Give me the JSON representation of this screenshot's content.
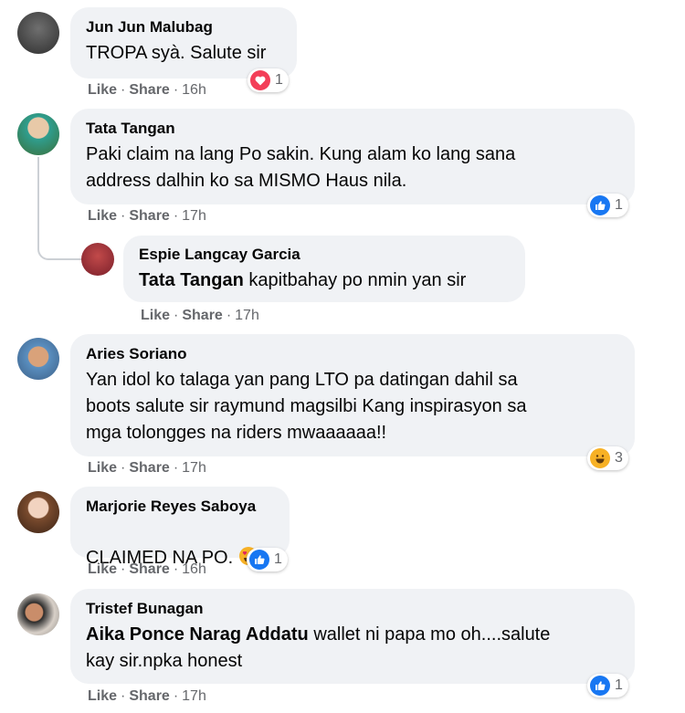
{
  "comments": [
    {
      "author": "Jun Jun Malubag",
      "text": "TROPA syà. Salute sir",
      "time": "16h",
      "reaction": "love",
      "reaction_count": "1"
    },
    {
      "author": "Tata Tangan",
      "text": "Paki claim na lang Po sakin. Kung alam ko lang sana\naddress dalhin ko sa MISMO Haus nila.",
      "time": "17h",
      "reaction": "like",
      "reaction_count": "1"
    },
    {
      "author": "Espie Langcay Garcia",
      "mention": "Tata Tangan",
      "text": " kapitbahay po nmin yan sir",
      "time": "17h"
    },
    {
      "author": "Aries Soriano",
      "text": "Yan idol ko talaga yan pang LTO pa datingan dahil sa\nboots salute sir raymund magsilbi Kang inspirasyon sa\nmga tolongges na riders mwaaaaaa!!",
      "time": "17h",
      "reaction": "haha",
      "reaction_count": "3"
    },
    {
      "author": "Marjorie Reyes Saboya",
      "text": "CLAIMED NA PO. ",
      "time": "16h",
      "reaction": "like",
      "reaction_count": "1"
    },
    {
      "author": "Tristef Bunagan",
      "mention": "Aika Ponce Narag Addatu",
      "text": " wallet ni papa mo oh....salute\nkay sir.npka honest",
      "time": "17h",
      "reaction": "like",
      "reaction_count": "1"
    }
  ],
  "labels": {
    "like": "Like",
    "share": "Share",
    "separator": "·"
  },
  "colors": {
    "bubble": "#f0f2f5",
    "meta": "#65676b",
    "like": "#1877f2",
    "love": "#f33e58",
    "haha": "#f7b125"
  },
  "icons": {
    "like": "thumbs-up-icon",
    "love": "heart-icon",
    "haha": "laugh-emoji-icon",
    "emoji_inline": "heart-eyes-emoji-icon"
  }
}
